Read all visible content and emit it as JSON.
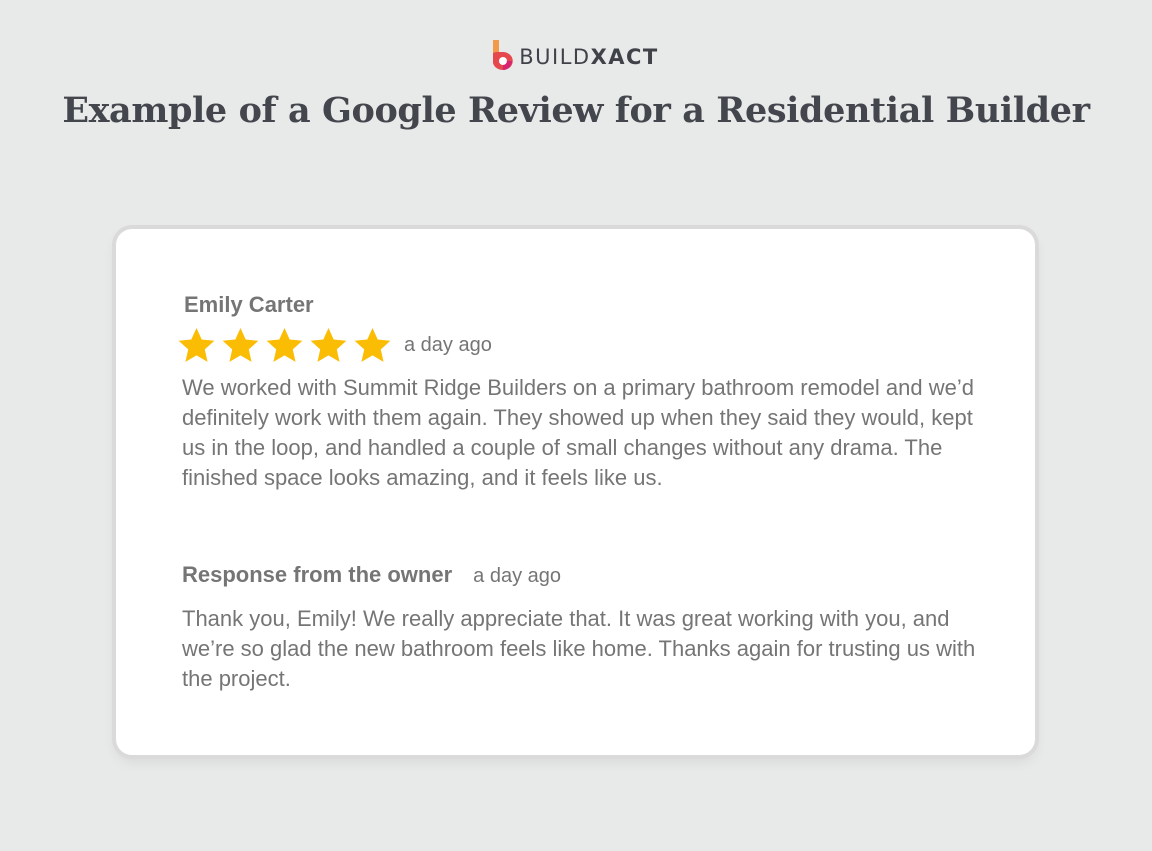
{
  "brand": {
    "name_light": "BUILD",
    "name_bold": "XACT",
    "logo_icon": "buildxact-logo-icon",
    "colors": {
      "logo_orange": "#f2994a",
      "logo_red": "#e5484d",
      "logo_magenta": "#d6246e"
    }
  },
  "page": {
    "title": "Example of a Google Review for a Residential Builder",
    "background": "#e8e9e9"
  },
  "review": {
    "reviewer_name": "Emily Carter",
    "rating": 5,
    "rating_max": 5,
    "star_color": "#fbbc04",
    "date": "a day ago",
    "text": "We worked with Summit Ridge Builders on a primary bathroom remodel and we’d definitely work with them again. They showed up when they said they would, kept us in the loop, and handled a couple of small changes without any drama. The finished space looks amazing, and it feels like us."
  },
  "response": {
    "label": "Response from the owner",
    "date": "a day ago",
    "text": "Thank you, Emily! We really appreciate that. It was great working with you, and we’re so glad the new bathroom feels like home. Thanks again for trusting us with the project."
  }
}
